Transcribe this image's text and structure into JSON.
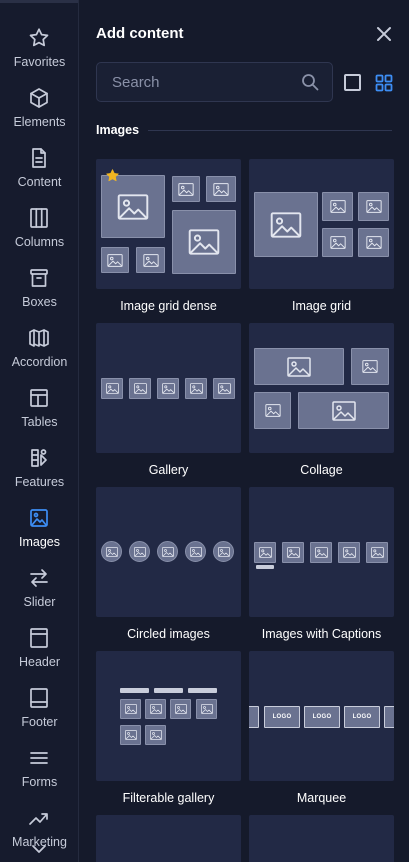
{
  "rail": {
    "items": [
      {
        "label": "Favorites",
        "icon": "star-icon"
      },
      {
        "label": "Elements",
        "icon": "cube-icon"
      },
      {
        "label": "Content",
        "icon": "document-icon"
      },
      {
        "label": "Columns",
        "icon": "columns-icon"
      },
      {
        "label": "Boxes",
        "icon": "archive-box-icon"
      },
      {
        "label": "Accordion",
        "icon": "accordion-icon"
      },
      {
        "label": "Tables",
        "icon": "table-icon"
      },
      {
        "label": "Features",
        "icon": "shapes-icon"
      },
      {
        "label": "Images",
        "icon": "image-icon",
        "active": true
      },
      {
        "label": "Slider",
        "icon": "arrows-swap-icon"
      },
      {
        "label": "Header",
        "icon": "header-icon"
      },
      {
        "label": "Footer",
        "icon": "footer-icon"
      },
      {
        "label": "Forms",
        "icon": "list-icon"
      },
      {
        "label": "Marketing",
        "icon": "trend-up-icon"
      }
    ]
  },
  "panel": {
    "title": "Add content",
    "search_placeholder": "Search",
    "section_title": "Images"
  },
  "cards": [
    {
      "label": "Image grid dense",
      "favorite": true
    },
    {
      "label": "Image grid"
    },
    {
      "label": "Gallery"
    },
    {
      "label": "Collage"
    },
    {
      "label": "Circled images"
    },
    {
      "label": "Images with Captions"
    },
    {
      "label": "Filterable gallery"
    },
    {
      "label": "Marquee"
    }
  ],
  "marquee_logo_text": "LOGO",
  "colors": {
    "background": "#151a2b",
    "card": "#222945",
    "accent": "#3d8ef5",
    "favorite_star": "#f1b521"
  }
}
